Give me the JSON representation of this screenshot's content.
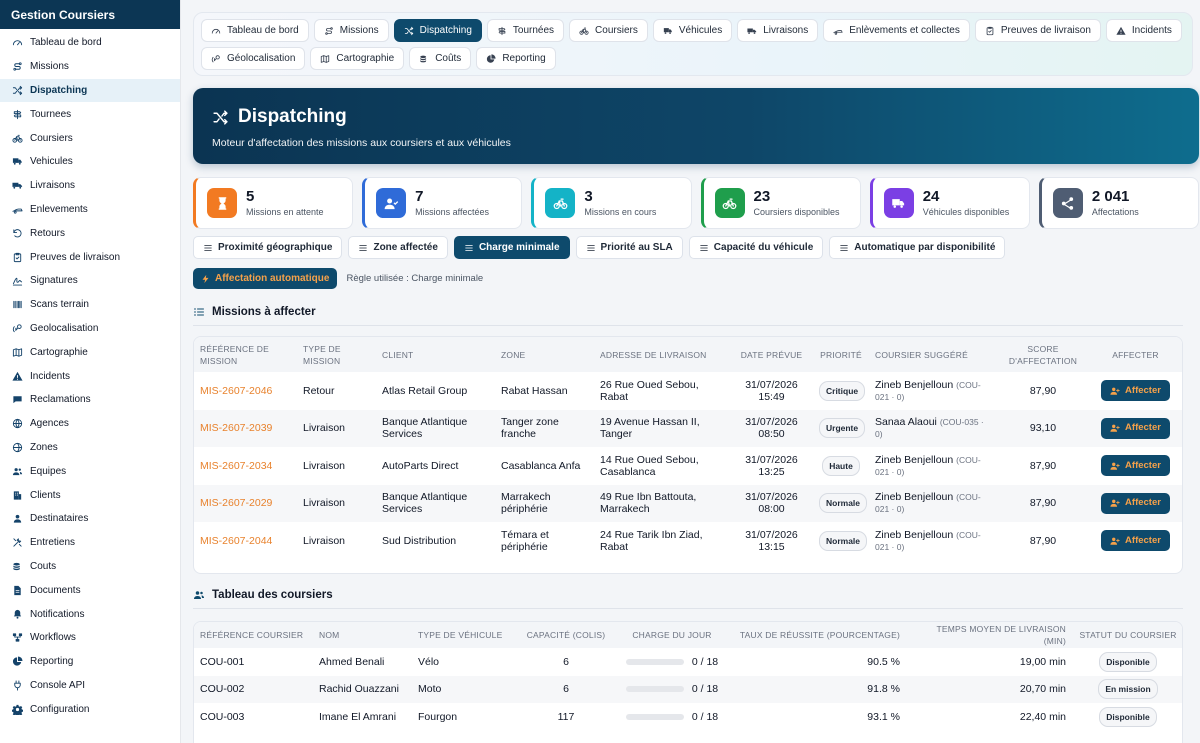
{
  "sidebar": {
    "title": "Gestion Coursiers",
    "items": [
      {
        "label": "Tableau de bord",
        "icon": "gauge-icon"
      },
      {
        "label": "Missions",
        "icon": "route-icon"
      },
      {
        "label": "Dispatching",
        "icon": "shuffle-icon",
        "active": true
      },
      {
        "label": "Tournees",
        "icon": "signpost-icon"
      },
      {
        "label": "Coursiers",
        "icon": "bicycle-icon"
      },
      {
        "label": "Vehicules",
        "icon": "truck-icon"
      },
      {
        "label": "Livraisons",
        "icon": "delivery-truck-icon"
      },
      {
        "label": "Enlevements",
        "icon": "dolly-icon"
      },
      {
        "label": "Retours",
        "icon": "undo-icon"
      },
      {
        "label": "Preuves de livraison",
        "icon": "clipboard-check-icon"
      },
      {
        "label": "Signatures",
        "icon": "signature-icon"
      },
      {
        "label": "Scans terrain",
        "icon": "barcode-icon"
      },
      {
        "label": "Geolocalisation",
        "icon": "satellite-icon"
      },
      {
        "label": "Cartographie",
        "icon": "map-icon"
      },
      {
        "label": "Incidents",
        "icon": "warning-icon"
      },
      {
        "label": "Reclamations",
        "icon": "chat-icon"
      },
      {
        "label": "Agences",
        "icon": "globe-icon"
      },
      {
        "label": "Zones",
        "icon": "globe-zones-icon"
      },
      {
        "label": "Equipes",
        "icon": "users-icon"
      },
      {
        "label": "Clients",
        "icon": "building-icon"
      },
      {
        "label": "Destinataires",
        "icon": "user-icon"
      },
      {
        "label": "Entretiens",
        "icon": "tools-icon"
      },
      {
        "label": "Couts",
        "icon": "coins-icon"
      },
      {
        "label": "Documents",
        "icon": "document-icon"
      },
      {
        "label": "Notifications",
        "icon": "bell-icon"
      },
      {
        "label": "Workflows",
        "icon": "workflow-icon"
      },
      {
        "label": "Reporting",
        "icon": "pie-chart-icon"
      },
      {
        "label": "Console API",
        "icon": "plug-icon"
      },
      {
        "label": "Configuration",
        "icon": "gear-icon"
      }
    ]
  },
  "topnav": {
    "items": [
      {
        "label": "Tableau de bord",
        "icon": "gauge-icon"
      },
      {
        "label": "Missions",
        "icon": "route-icon"
      },
      {
        "label": "Dispatching",
        "icon": "shuffle-icon",
        "active": true
      },
      {
        "label": "Tournées",
        "icon": "signpost-icon"
      },
      {
        "label": "Coursiers",
        "icon": "bicycle-icon"
      },
      {
        "label": "Véhicules",
        "icon": "truck-icon"
      },
      {
        "label": "Livraisons",
        "icon": "delivery-truck-icon"
      },
      {
        "label": "Enlèvements et collectes",
        "icon": "dolly-icon"
      },
      {
        "label": "Preuves de livraison",
        "icon": "clipboard-check-icon"
      },
      {
        "label": "Incidents",
        "icon": "warning-icon"
      },
      {
        "label": "Géolocalisation",
        "icon": "satellite-icon"
      },
      {
        "label": "Cartographie",
        "icon": "map-icon"
      },
      {
        "label": "Coûts",
        "icon": "coins-icon"
      },
      {
        "label": "Reporting",
        "icon": "pie-chart-icon"
      }
    ]
  },
  "hero": {
    "title": "Dispatching",
    "subtitle": "Moteur d'affectation des missions aux coursiers et aux véhicules"
  },
  "stats": [
    {
      "value": "5",
      "label": "Missions en attente",
      "color": "#f27a22",
      "icon": "hourglass-icon"
    },
    {
      "value": "7",
      "label": "Missions affectées",
      "color": "#2f6bd8",
      "icon": "user-check-icon"
    },
    {
      "value": "3",
      "label": "Missions en cours",
      "color": "#14b3c7",
      "icon": "bicycle-icon"
    },
    {
      "value": "23",
      "label": "Coursiers disponibles",
      "color": "#1f9e4c",
      "icon": "bicycle-icon"
    },
    {
      "value": "24",
      "label": "Véhicules disponibles",
      "color": "#7b3fe4",
      "icon": "truck-icon"
    },
    {
      "value": "2 041",
      "label": "Affectations",
      "color": "#4f5d73",
      "icon": "share-icon"
    }
  ],
  "rules": [
    {
      "label": "Proximité géographique"
    },
    {
      "label": "Zone affectée"
    },
    {
      "label": "Charge minimale",
      "active": true
    },
    {
      "label": "Priorité au SLA"
    },
    {
      "label": "Capacité du véhicule"
    },
    {
      "label": "Automatique par disponibilité"
    }
  ],
  "auto": {
    "button_label": "Affectation automatique",
    "rule_text": "Règle utilisée : Charge minimale"
  },
  "missions": {
    "title": "Missions à affecter",
    "columns": [
      "Référence de mission",
      "Type de mission",
      "Client",
      "Zone",
      "Adresse de livraison",
      "Date prévue",
      "Priorité",
      "Coursier suggéré",
      "Score d'affectation",
      "Affecter"
    ],
    "action_label": "Affecter",
    "rows": [
      {
        "ref": "MIS-2607-2046",
        "type": "Retour",
        "client": "Atlas Retail Group",
        "zone": "Rabat Hassan",
        "address": "26 Rue Oued Sebou, Rabat",
        "date": "31/07/2026",
        "time": "15:49",
        "priority": "Critique",
        "courier": "Zineb Benjelloun",
        "courier_code": "(COU-021 · 0)",
        "score": "87,90"
      },
      {
        "ref": "MIS-2607-2039",
        "type": "Livraison",
        "client": "Banque Atlantique Services",
        "zone": "Tanger zone franche",
        "address": "19 Avenue Hassan II, Tanger",
        "date": "31/07/2026",
        "time": "08:50",
        "priority": "Urgente",
        "courier": "Sanaa Alaoui",
        "courier_code": "(COU-035 · 0)",
        "score": "93,10"
      },
      {
        "ref": "MIS-2607-2034",
        "type": "Livraison",
        "client": "AutoParts Direct",
        "zone": "Casablanca Anfa",
        "address": "14 Rue Oued Sebou, Casablanca",
        "date": "31/07/2026",
        "time": "13:25",
        "priority": "Haute",
        "courier": "Zineb Benjelloun",
        "courier_code": "(COU-021 · 0)",
        "score": "87,90"
      },
      {
        "ref": "MIS-2607-2029",
        "type": "Livraison",
        "client": "Banque Atlantique Services",
        "zone": "Marrakech périphérie",
        "address": "49 Rue Ibn Battouta, Marrakech",
        "date": "31/07/2026",
        "time": "08:00",
        "priority": "Normale",
        "courier": "Zineb Benjelloun",
        "courier_code": "(COU-021 · 0)",
        "score": "87,90"
      },
      {
        "ref": "MIS-2607-2044",
        "type": "Livraison",
        "client": "Sud Distribution",
        "zone": "Témara et périphérie",
        "address": "24 Rue Tarik Ibn Ziad, Rabat",
        "date": "31/07/2026",
        "time": "13:15",
        "priority": "Normale",
        "courier": "Zineb Benjelloun",
        "courier_code": "(COU-021 · 0)",
        "score": "87,90"
      }
    ]
  },
  "couriers": {
    "title": "Tableau des coursiers",
    "columns": [
      "Référence coursier",
      "Nom",
      "Type de véhicule",
      "Capacité (colis)",
      "Charge du jour",
      "Taux de réussite (pourcentage)",
      "Temps moyen de livraison (min)",
      "Statut du coursier"
    ],
    "rows": [
      {
        "ref": "COU-001",
        "name": "Ahmed Benali",
        "vehicle": "Vélo",
        "capacity": "6",
        "load": 0,
        "load_text": "0 / 18",
        "rate": "90.5 %",
        "time": "19,00 min",
        "status": "Disponible"
      },
      {
        "ref": "COU-002",
        "name": "Rachid Ouazzani",
        "vehicle": "Moto",
        "capacity": "6",
        "load": 0,
        "load_text": "0 / 18",
        "rate": "91.8 %",
        "time": "20,70 min",
        "status": "En mission"
      },
      {
        "ref": "COU-003",
        "name": "Imane El Amrani",
        "vehicle": "Fourgon",
        "capacity": "117",
        "load": 0,
        "load_text": "0 / 18",
        "rate": "93.1 %",
        "time": "22,40 min",
        "status": "Disponible"
      }
    ]
  }
}
